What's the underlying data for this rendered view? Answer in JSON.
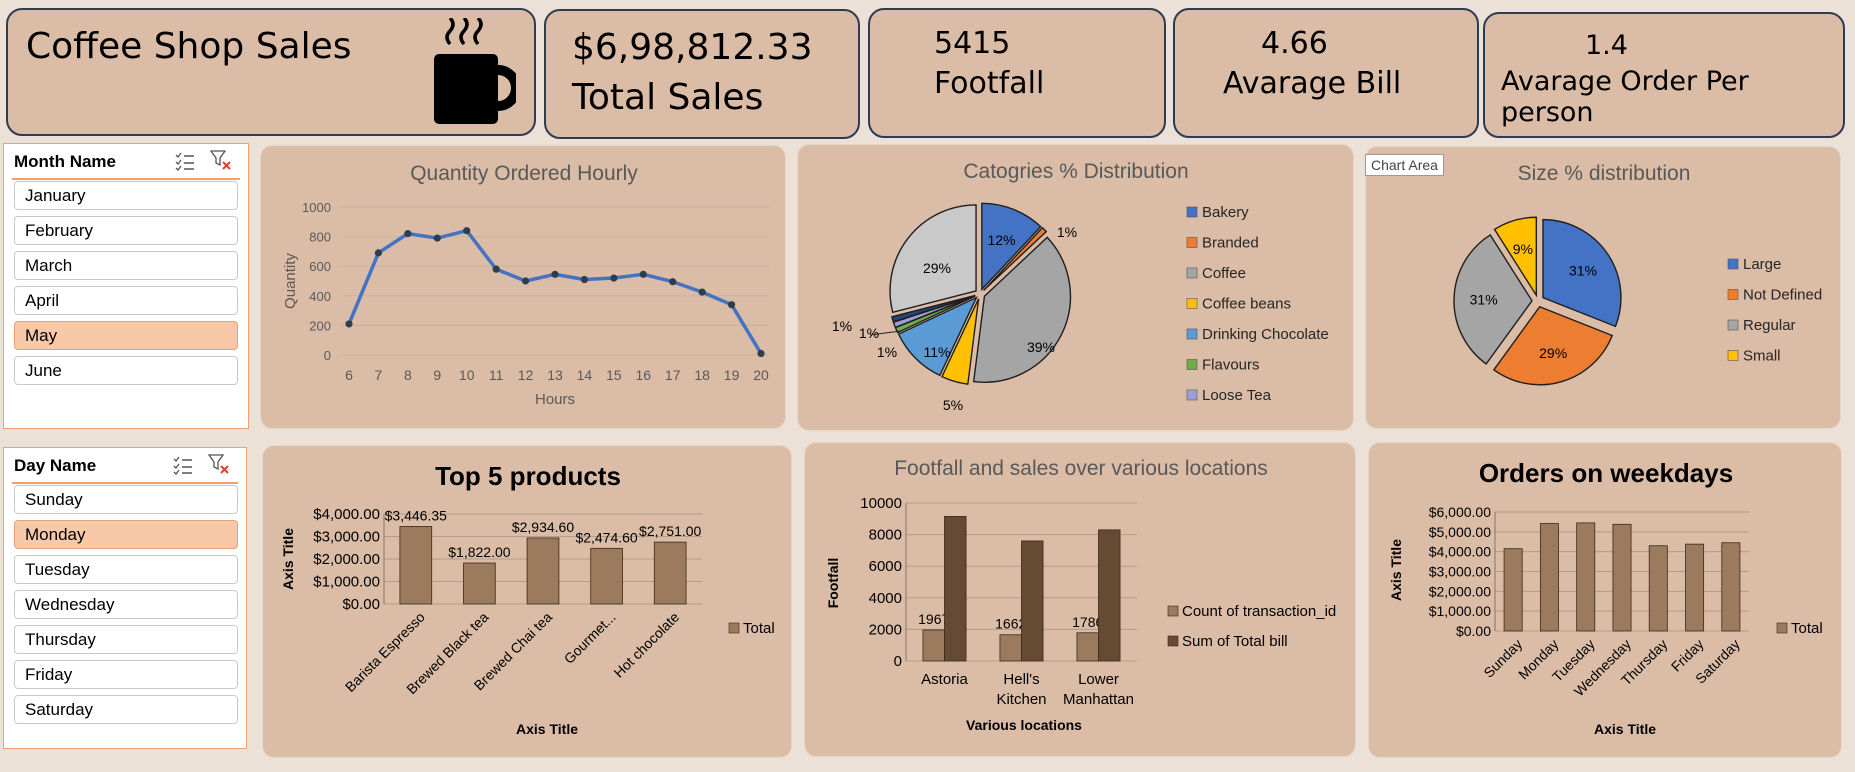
{
  "kpis": {
    "title": "Coffee Shop Sales",
    "total_sales_value": "$6,98,812.33",
    "total_sales_label": "Total Sales",
    "footfall_value": "5415",
    "footfall_label": "Footfall",
    "avg_bill_value": "4.66",
    "avg_bill_label": "Avarage Bill",
    "avg_order_value": "1.4",
    "avg_order_label": "Avarage Order Per person"
  },
  "slicers": {
    "month": {
      "header": "Month Name",
      "items": [
        "January",
        "February",
        "March",
        "April",
        "May",
        "June"
      ],
      "selected": "May"
    },
    "day": {
      "header": "Day Name",
      "items": [
        "Sunday",
        "Monday",
        "Tuesday",
        "Wednesday",
        "Thursday",
        "Friday",
        "Saturday"
      ],
      "selected": "Monday"
    }
  },
  "tooltip": "Chart Area",
  "colors": {
    "card": "#dbbca6",
    "bar": "#9c7a5e",
    "bar_dark": "#654a34",
    "line": "#4472c4",
    "accent": "#f0a070"
  },
  "chart_data": [
    {
      "id": "hourly",
      "type": "line",
      "title": "Quantity Ordered Hourly",
      "xlabel": "Hours",
      "ylabel": "Quantity",
      "x": [
        6,
        7,
        8,
        9,
        10,
        11,
        12,
        13,
        14,
        15,
        16,
        17,
        18,
        19,
        20
      ],
      "values": [
        210,
        690,
        820,
        790,
        840,
        580,
        500,
        545,
        510,
        520,
        545,
        495,
        425,
        340,
        10
      ],
      "yticks": [
        0,
        200,
        400,
        600,
        800,
        1000
      ],
      "ylim": [
        0,
        1000
      ],
      "grid": true
    },
    {
      "id": "categories",
      "type": "pie",
      "title": "Catogries % Distribution",
      "legend": [
        "Bakery",
        "Branded",
        "Coffee",
        "Coffee beans",
        "Drinking Chocolate",
        "Flavours",
        "Loose Tea"
      ],
      "slices": [
        {
          "name": "Bakery",
          "value": 12,
          "label": "12%",
          "color": "#4472c4"
        },
        {
          "name": "Branded",
          "value": 1,
          "label": "1%",
          "color": "#ed7d31"
        },
        {
          "name": "Coffee",
          "value": 39,
          "label": "39%",
          "color": "#a5a5a5"
        },
        {
          "name": "Coffee beans",
          "value": 5,
          "label": "5%",
          "color": "#ffc000"
        },
        {
          "name": "Drinking Chocolate",
          "value": 11,
          "label": "11%",
          "color": "#5b9bd5"
        },
        {
          "name": "Flavours",
          "value": 1,
          "label": "1%",
          "color": "#70ad47"
        },
        {
          "name": "Loose Tea",
          "value": 1,
          "label": "1%",
          "color": "#9e9ed8"
        },
        {
          "name": "",
          "value": 1,
          "label": "1%",
          "color": "#264478"
        },
        {
          "name": "",
          "value": 29,
          "label": "29%",
          "color": "#c9c9c9"
        }
      ]
    },
    {
      "id": "sizes",
      "type": "pie",
      "title": "Size % distribution",
      "legend": [
        "Large",
        "Not Defined",
        "Regular",
        "Small"
      ],
      "slices": [
        {
          "name": "Large",
          "value": 31,
          "label": "31%",
          "color": "#4472c4"
        },
        {
          "name": "Not Defined",
          "value": 29,
          "label": "29%",
          "color": "#ed7d31"
        },
        {
          "name": "Regular",
          "value": 31,
          "label": "31%",
          "color": "#a5a5a5"
        },
        {
          "name": "Small",
          "value": 9,
          "label": "9%",
          "color": "#ffc000"
        }
      ]
    },
    {
      "id": "top5",
      "type": "bar",
      "title": "Top 5 products",
      "categories": [
        "Barista Espresso",
        "Brewed Black tea",
        "Brewed Chai tea",
        "Gourmet...",
        "Hot chocolate"
      ],
      "values": [
        3446.35,
        1822.0,
        2934.6,
        2474.6,
        2751.0
      ],
      "data_labels": [
        "$3,446.35",
        "$1,822.00",
        "$2,934.60",
        "$2,474.60",
        "$2,751.00"
      ],
      "yticks": [
        "$0.00",
        "$1,000.00",
        "$2,000.00",
        "$3,000.00",
        "$4,000.00"
      ],
      "ylim": [
        0,
        4000
      ],
      "xlabel": "Axis Title",
      "ylabel": "Axis Title",
      "legend": [
        "Total"
      ]
    },
    {
      "id": "locations",
      "type": "bar",
      "title": "Footfall and sales over various locations",
      "categories": [
        "Astoria",
        "Hell's Kitchen",
        "Lower Manhattan"
      ],
      "series": [
        {
          "name": "Count of transaction_id",
          "values": [
            1967,
            1662,
            1786
          ],
          "labels": [
            "1967",
            "1662",
            "1786"
          ]
        },
        {
          "name": "Sum of Total bill",
          "values": [
            9150,
            7600,
            8300
          ]
        }
      ],
      "yticks": [
        "0",
        "2000",
        "4000",
        "6000",
        "8000",
        "10000"
      ],
      "ylim": [
        0,
        10000
      ],
      "xlabel": "Various locations",
      "ylabel": "Footfall"
    },
    {
      "id": "weekdays",
      "type": "bar",
      "title": "Orders on weekdays",
      "categories": [
        "Sunday",
        "Monday",
        "Tuesday",
        "Wednesday",
        "Thursday",
        "Friday",
        "Saturday"
      ],
      "values": [
        4150,
        5420,
        5450,
        5380,
        4300,
        4380,
        4450
      ],
      "yticks": [
        "$0.00",
        "$1,000.00",
        "$2,000.00",
        "$3,000.00",
        "$4,000.00",
        "$5,000.00",
        "$6,000.00"
      ],
      "ylim": [
        0,
        6000
      ],
      "xlabel": "Axis Title",
      "ylabel": "Axis Title",
      "legend": [
        "Total"
      ]
    }
  ]
}
